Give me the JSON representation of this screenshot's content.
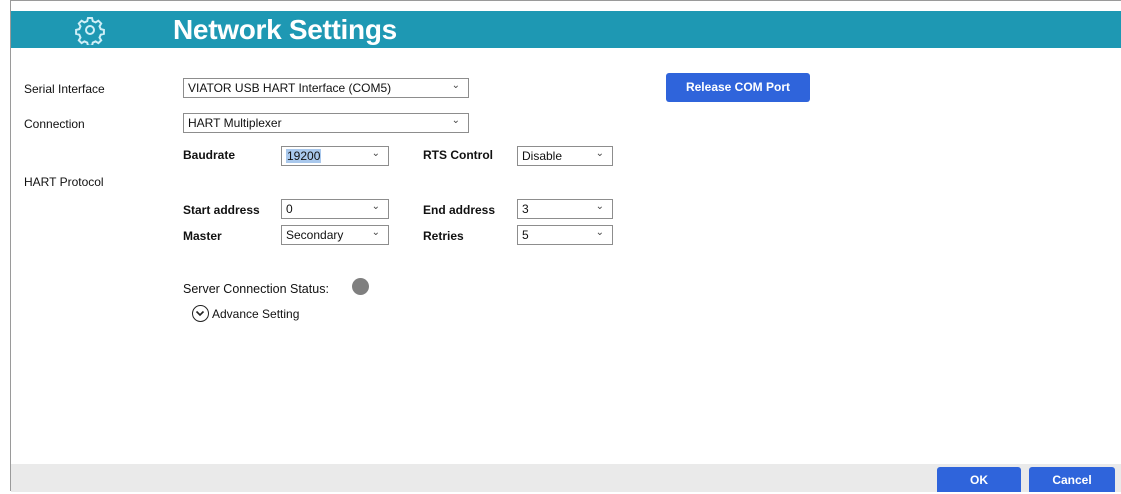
{
  "header": {
    "title": "Network Settings",
    "icon": "gear-icon",
    "color": "#1e98b3"
  },
  "form": {
    "serial_interface": {
      "label": "Serial Interface",
      "value": "VIATOR USB HART Interface (COM5)"
    },
    "connection": {
      "label": "Connection",
      "value": "HART Multiplexer"
    },
    "hart_protocol_label": "HART Protocol",
    "baudrate": {
      "label": "Baudrate",
      "value": "19200"
    },
    "rts_control": {
      "label": "RTS Control",
      "value": "Disable"
    },
    "start_address": {
      "label": "Start address",
      "value": "0"
    },
    "end_address": {
      "label": "End address",
      "value": "3"
    },
    "master": {
      "label": "Master",
      "value": "Secondary"
    },
    "retries": {
      "label": "Retries",
      "value": "5"
    }
  },
  "release_button": "Release COM Port",
  "server_status": {
    "label": "Server Connection Status:",
    "color": "#7f7f7f"
  },
  "advance_setting": "Advance Setting",
  "footer": {
    "ok": "OK",
    "cancel": "Cancel"
  },
  "colors": {
    "button": "#2f64db",
    "footer_bg": "#eaeaea"
  }
}
